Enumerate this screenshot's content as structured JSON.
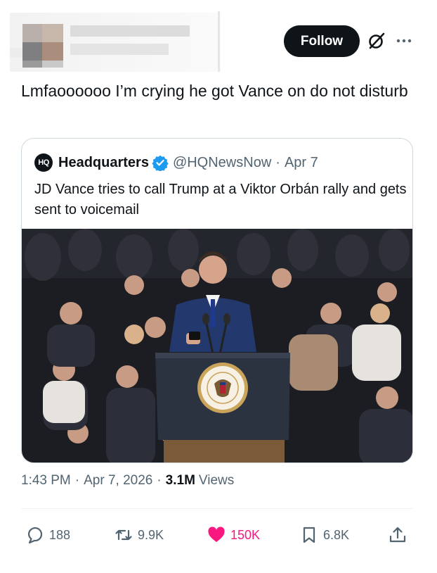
{
  "header": {
    "follow_label": "Follow"
  },
  "tweet": {
    "text": "Lmfaoooooo I’m crying he got Vance on do not disturb"
  },
  "quote": {
    "avatar_text": "HQ",
    "name": "Headquarters",
    "handle": "@HQNewsNow",
    "date": "Apr 7",
    "text": "JD Vance tries to call Trump at a Viktor Orbán rally and gets sent to voicemail"
  },
  "meta": {
    "time": "1:43 PM",
    "date": "Apr 7, 2026",
    "views_count": "3.1M",
    "views_label": "Views"
  },
  "actions": {
    "replies": "188",
    "reposts": "9.9K",
    "likes": "150K",
    "bookmarks": "6.8K"
  },
  "icons": {
    "grok": "grok-icon",
    "more": "more-icon",
    "verified": "verified-badge-icon",
    "reply": "reply-icon",
    "repost": "repost-icon",
    "like": "heart-icon",
    "bookmark": "bookmark-icon",
    "share": "share-icon"
  },
  "colors": {
    "like_active": "#f91880",
    "verified": "#1d9bf0",
    "muted": "#536471"
  }
}
